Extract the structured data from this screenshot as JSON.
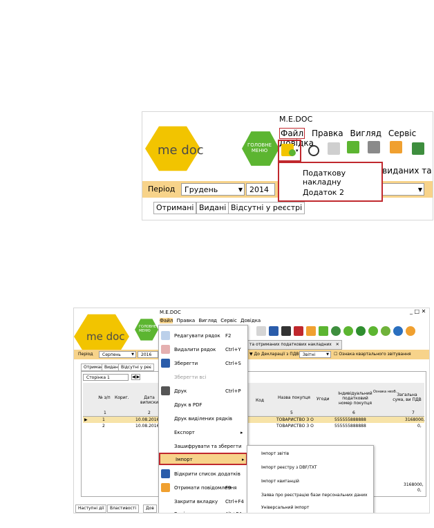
{
  "top": {
    "window_title": "M.E.DOC",
    "menu": [
      "Файл",
      "Правка",
      "Вигляд",
      "Сервіс",
      "Довідка"
    ],
    "logo_text": "me doc",
    "main_menu_label": "ГОЛОВНЕ\nМЕНЮ",
    "dropdown": [
      "Податкову накладну",
      "Додаток 2"
    ],
    "partial_tab": "о виданих та с",
    "period_label": "Період",
    "period_month": "Грудень",
    "period_year": "2014",
    "tabs": [
      "Отримані",
      "Видані",
      "Відсутні у реєстрі"
    ]
  },
  "bottom": {
    "window_title": "M.E.DOC",
    "menu": [
      "Файл",
      "Правка",
      "Вигляд",
      "Сервіс",
      "Довідка"
    ],
    "logo_text": "me doc",
    "main_menu_label": "ГОЛОВНЕ\nМЕНЮ",
    "doc_tab": "та отриманих податкових накладних",
    "doc_tab_close": "✕",
    "period_label": "Період",
    "period_month": "Серпень",
    "period_year": "2016",
    "declaration_button": "До Декларації з ПДВ",
    "declaration_status": "Звітні",
    "quarterly_label": "Ознака квартального звітування",
    "tabs": [
      "Отримані",
      "Видані",
      "Відсутні у реє"
    ],
    "page_selector": "Сторінка 1",
    "grid_headers": [
      "№ з/п",
      "Кориг.",
      "Дата виписки",
      "Код",
      "Назва покупця",
      "Угоди",
      "Індивідуальний податковий номер покупця",
      "Ознака незб.",
      "Загальна сума, ви ПДВ"
    ],
    "grid_numbers": [
      "1",
      "2",
      "5",
      "6",
      "7"
    ],
    "rows": [
      {
        "n": "1",
        "date": "10.08.2016",
        "buyer": "ТОВАРИСТВО З О",
        "ipn": "555555888888",
        "sum": "3168000,"
      },
      {
        "n": "2",
        "date": "10.08.2016",
        "buyer": "ТОВАРИСТВО З О",
        "ipn": "555555888888",
        "sum": "0,"
      }
    ],
    "footer_sums": [
      "3168000,",
      "0,"
    ],
    "file_menu": [
      {
        "label": "Редагувати рядок",
        "shortcut": "F2"
      },
      {
        "label": "Видалити рядок",
        "shortcut": "Ctrl+Y"
      },
      {
        "label": "Зберегти",
        "shortcut": "Ctrl+S"
      },
      {
        "label": "Зберегти всі",
        "shortcut": ""
      },
      {
        "label": "Друк",
        "shortcut": "Ctrl+P"
      },
      {
        "label": "Друк в PDF",
        "shortcut": ""
      },
      {
        "label": "Друк виділених рядків",
        "shortcut": ""
      },
      {
        "label": "Експорт",
        "shortcut": ""
      },
      {
        "label": "Зашифрувати та зберегти",
        "shortcut": ""
      },
      {
        "label": "Імпорт",
        "shortcut": ""
      },
      {
        "label": "Відкрити список додатків",
        "shortcut": ""
      },
      {
        "label": "Отримати повідомлення",
        "shortcut": "F9"
      },
      {
        "label": "Закрити вкладку",
        "shortcut": "Ctrl+F4"
      },
      {
        "label": "Вихід",
        "shortcut": "Alt+F4"
      }
    ],
    "import_submenu": [
      "Імпорт звітів",
      "Імпорт реєстру з DBF/TXT",
      "Імпорт квитанцій",
      "Заява про реєстрацію бази персональних даних",
      "Універсальний імпорт"
    ],
    "bottom_tabs": [
      "Наступні дії",
      "Властивості",
      "Дов"
    ]
  },
  "colors": {
    "accent_red": "#c0282d",
    "logo_yellow": "#f2c400",
    "menu_green": "#5cb531",
    "orange_bar": "#f7d38a"
  }
}
